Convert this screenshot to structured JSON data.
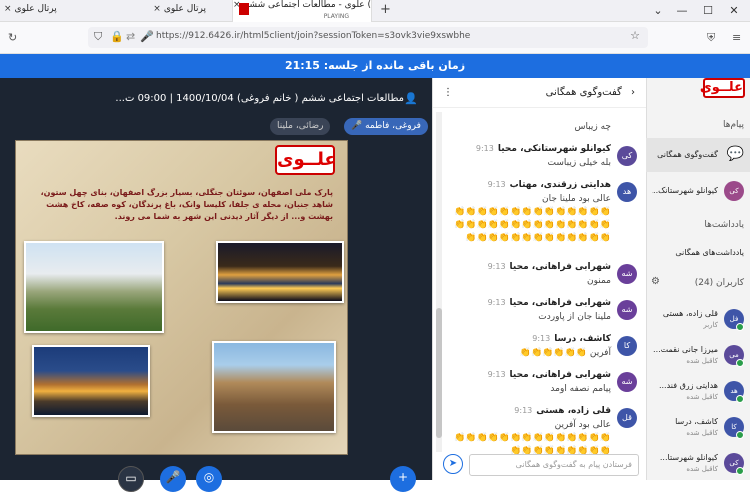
{
  "browser": {
    "tabs": [
      {
        "label": "پرتال علوی",
        "close": "×"
      },
      {
        "label": "پرتال علوی",
        "close": "×"
      },
      {
        "label": "علوی - مطالعات اجتماعی ششم (",
        "sublabel": "PLAYING",
        "close": "×"
      }
    ],
    "new_tab": "+",
    "url": "https://912.6426.ir/html5client/join?sessionToken=s3ovk3vie9xswbhe"
  },
  "banner": {
    "text": "زمان باقی مانده از جلسه: 21:15"
  },
  "presentation": {
    "title": "مطالعات اجتماعی ششم ( خانم فروغی) 1400/10/04 | 09:00 ت...",
    "chips": [
      "فروغی، فاطمه",
      "رضائی، ملینا"
    ],
    "slide_logo": "علــوی",
    "slide_text": "پارک ملی اصفهان، سوئتان جنگلی، بسیار بزرگ اصفهان، بنای چهل ستون، شاهد جنبان، محله ی جلفا، کلیسا وانک، باغ پرندگان، کوه صفه، کاخ هشت بهشت و... از دیگر آثار دیدنی این شهر به شما می روند."
  },
  "chat": {
    "header": "گفت‌وگوی همگانی",
    "messages": [
      {
        "text": "چه زیباس"
      },
      {
        "initials": "کی",
        "name": "کیوانلو شهرستانکی، محیا",
        "time": "9:13",
        "text": "بله خیلی زیباست"
      },
      {
        "initials": "هد",
        "name": "هدایتی زرقندی، مهتاب",
        "time": "9:13",
        "text": "عالی بود ملینا جان",
        "emojis": "👏👏👏👏👏👏👏👏👏👏👏👏👏👏👏👏👏👏👏👏👏👏👏👏👏👏👏👏👏👏👏👏👏👏👏👏👏👏👏👏👏"
      },
      {
        "initials": "شه",
        "name": "شهرابی فراهانی، محیا",
        "time": "9:13",
        "text": "ممنون"
      },
      {
        "initials": "شه",
        "name": "شهرابی فراهانی، محیا",
        "time": "9:13",
        "text": "ملینا جان از پاوردت"
      },
      {
        "initials": "کا",
        "name": "کاشف، درسا",
        "time": "9:13",
        "text": "آفرین 👏👏👏👏👏👏"
      },
      {
        "initials": "شه",
        "name": "شهرابی فراهانی، محیا",
        "time": "9:13",
        "text": "پیامم نصفه اومد"
      },
      {
        "initials": "قل",
        "name": "قلی زاده، هستی",
        "time": "9:13",
        "text": "عالی بود آفرین",
        "emojis": "👏👏👏👏👏👏👏👏👏👏👏👏👏👏👏👏👏👏👏👏👏👏👏"
      }
    ],
    "input_placeholder": "فرستادن پیام به گفت‌وگوی همگانی"
  },
  "sidebar": {
    "logo": "علــوی",
    "messages_label": "پیام‌ها",
    "public_chat": "گفت‌وگوی همگانی",
    "private_chat": {
      "initials": "کی",
      "name": "کیوانلو شهرستانک..."
    },
    "notes_label": "یادداشت‌ها",
    "shared_notes": "یادداشت‌های همگانی",
    "users_label": "کاربران (24)",
    "users": [
      {
        "initials": "فل",
        "name": "قلی زاده، هستی",
        "status": "کاربر"
      },
      {
        "initials": "می",
        "name": "میرزا جانی نقمت...",
        "status": "کاقبل شده"
      },
      {
        "initials": "هد",
        "name": "هدایتی زرق فند...",
        "status": "کاقبل شده"
      },
      {
        "initials": "کا",
        "name": "کاشف، درسا",
        "status": "کاقبل شده"
      },
      {
        "initials": "کی",
        "name": "کیوانلو شهرستا...",
        "status": "کاقبل شده"
      }
    ]
  }
}
